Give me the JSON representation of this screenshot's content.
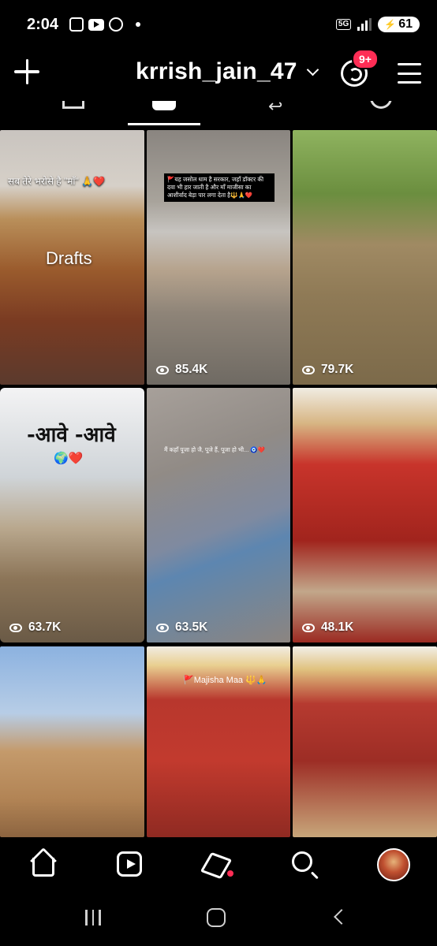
{
  "status_bar": {
    "time": "2:04",
    "network": "5G",
    "battery": "61"
  },
  "header": {
    "username": "krrish_jain_47",
    "notification_badge": "9+"
  },
  "tabs": [
    "grid",
    "reels",
    "tagged"
  ],
  "grid": {
    "tiles": [
      {
        "id": 1,
        "label": "Drafts",
        "caption": "सब तेरे भरोसे है \"माँ\" 🙏❤️",
        "views": ""
      },
      {
        "id": 2,
        "caption": "🚩यह जसोल धाम है सरकार, जहाँ डॉक्टर की दवा भी हार जाती है और माँ माजीसा का आशीर्वाद बेड़ा पार लगा देता है🔱🙏❤️",
        "views": "85.4K"
      },
      {
        "id": 3,
        "caption": "",
        "views": "79.7K"
      },
      {
        "id": 4,
        "caption": "-आवे -आवे",
        "emoji": "🌍❤️",
        "views": "63.7K"
      },
      {
        "id": 5,
        "caption": "मैं कहाँ पूजा हो जै, पूजे हैं, पूजा हो भी... 🧿❤️",
        "views": "63.5K"
      },
      {
        "id": 6,
        "caption": "",
        "views": "48.1K"
      },
      {
        "id": 7,
        "caption": "",
        "views": ""
      },
      {
        "id": 8,
        "caption": "🚩Majisha Maa 🔱🙏",
        "views": ""
      },
      {
        "id": 9,
        "caption": "",
        "views": ""
      }
    ]
  },
  "bottom_nav": [
    "home",
    "reels",
    "messages",
    "search",
    "profile"
  ],
  "icons": {
    "new_post": "plus-icon",
    "threads": "threads-icon",
    "menu": "menu-icon",
    "views": "eye-icon"
  },
  "colors": {
    "background": "#000000",
    "badge": "#ff2d55",
    "text": "#ffffff"
  }
}
